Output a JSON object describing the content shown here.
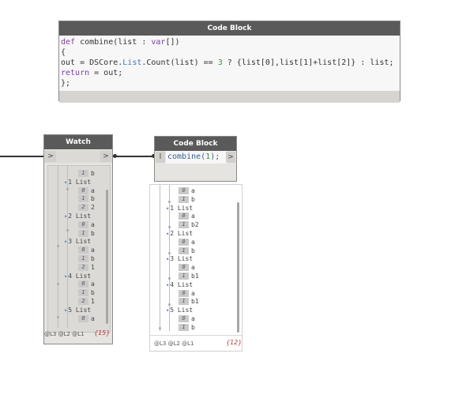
{
  "codeblock_top": {
    "title": "Code Block",
    "lines": [
      [
        {
          "t": "def",
          "c": "kw"
        },
        {
          "t": " combine(list : "
        },
        {
          "t": "var",
          "c": "kw"
        },
        {
          "t": "[])"
        }
      ],
      [
        {
          "t": "{"
        }
      ],
      [
        {
          "t": "out = DSCore."
        },
        {
          "t": "List",
          "c": "ty"
        },
        {
          "t": ".Count(list) == "
        },
        {
          "t": "3",
          "c": "num"
        },
        {
          "t": " ? {list[0],list[1]+list[2]} : list;"
        }
      ],
      [
        {
          "t": "return",
          "c": "kw"
        },
        {
          "t": " = out;"
        }
      ],
      [
        {
          "t": "};"
        }
      ]
    ]
  },
  "watch_node": {
    "title": "Watch",
    "input_port": ">",
    "output_port": ">",
    "levels": "@L3 @L2 @L1",
    "count": "{15}",
    "rows": [
      {
        "type": "item",
        "index": "1",
        "value": "b"
      },
      {
        "type": "list",
        "index": "1",
        "value": "List"
      },
      {
        "type": "item",
        "index": "0",
        "value": "a"
      },
      {
        "type": "item",
        "index": "1",
        "value": "b"
      },
      {
        "type": "item",
        "index": "2",
        "value": "2"
      },
      {
        "type": "list",
        "index": "2",
        "value": "List"
      },
      {
        "type": "item",
        "index": "0",
        "value": "a"
      },
      {
        "type": "item",
        "index": "1",
        "value": "b"
      },
      {
        "type": "list",
        "index": "3",
        "value": "List"
      },
      {
        "type": "item",
        "index": "0",
        "value": "a"
      },
      {
        "type": "item",
        "index": "1",
        "value": "b"
      },
      {
        "type": "item",
        "index": "2",
        "value": "1"
      },
      {
        "type": "list",
        "index": "4",
        "value": "List"
      },
      {
        "type": "item",
        "index": "0",
        "value": "a"
      },
      {
        "type": "item",
        "index": "1",
        "value": "b"
      },
      {
        "type": "item",
        "index": "2",
        "value": "1"
      },
      {
        "type": "list",
        "index": "5",
        "value": "List"
      },
      {
        "type": "item",
        "index": "0",
        "value": "a"
      }
    ]
  },
  "codeblock_call": {
    "title": "Code Block",
    "input_port": "l",
    "output_port": ">",
    "code_fn": "combine(",
    "code_arg": "1",
    "code_end": ");"
  },
  "preview": {
    "levels": "@L3 @L2 @L1",
    "count": "{12}",
    "rows": [
      {
        "type": "item",
        "index": "0",
        "value": "a"
      },
      {
        "type": "item",
        "index": "1",
        "value": "b"
      },
      {
        "type": "list",
        "index": "1",
        "value": "List"
      },
      {
        "type": "item",
        "index": "0",
        "value": "a"
      },
      {
        "type": "item",
        "index": "1",
        "value": "b2"
      },
      {
        "type": "list",
        "index": "2",
        "value": "List"
      },
      {
        "type": "item",
        "index": "0",
        "value": "a"
      },
      {
        "type": "item",
        "index": "1",
        "value": "b"
      },
      {
        "type": "list",
        "index": "3",
        "value": "List"
      },
      {
        "type": "item",
        "index": "0",
        "value": "a"
      },
      {
        "type": "item",
        "index": "1",
        "value": "b1"
      },
      {
        "type": "list",
        "index": "4",
        "value": "List"
      },
      {
        "type": "item",
        "index": "0",
        "value": "a"
      },
      {
        "type": "item",
        "index": "1",
        "value": "b1"
      },
      {
        "type": "list",
        "index": "5",
        "value": "List"
      },
      {
        "type": "item",
        "index": "0",
        "value": "a"
      },
      {
        "type": "item",
        "index": "1",
        "value": "b"
      }
    ]
  }
}
